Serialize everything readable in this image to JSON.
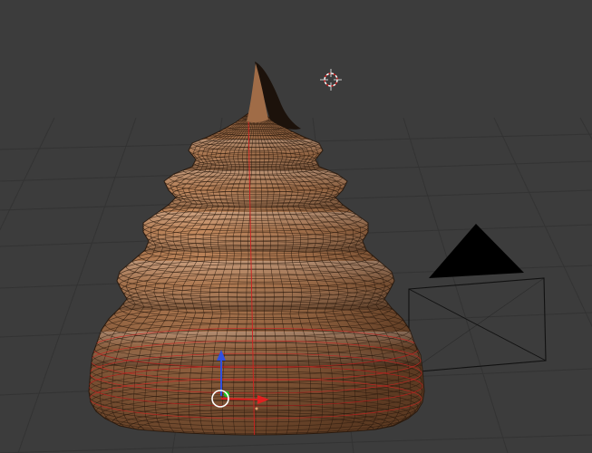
{
  "viewport": {
    "view": "3D Viewport",
    "shading": "solid",
    "overlay": "wireframe",
    "show_grid_floor": true
  },
  "scene": {
    "objects": [
      {
        "type": "mesh",
        "shape": "swirl",
        "selected": true
      },
      {
        "type": "camera"
      }
    ],
    "cursor_3d": {
      "visible": true
    },
    "transform_manipulator": {
      "visible": true,
      "axes": [
        "x",
        "y",
        "z"
      ]
    }
  },
  "colors": {
    "background": "#3c3c3c",
    "grid_line": "#333333",
    "mesh_fill": "#9a6845",
    "mesh_wire": "#2a1a0e",
    "seam": "#d02020",
    "x_axis": "#e02020",
    "y_axis": "#20c020",
    "z_axis": "#3050e0",
    "camera_wire": "#111111"
  },
  "icons": {
    "cursor": "3d-cursor-icon",
    "manipulator": "transform-gizmo-icon",
    "camera": "camera-icon"
  }
}
